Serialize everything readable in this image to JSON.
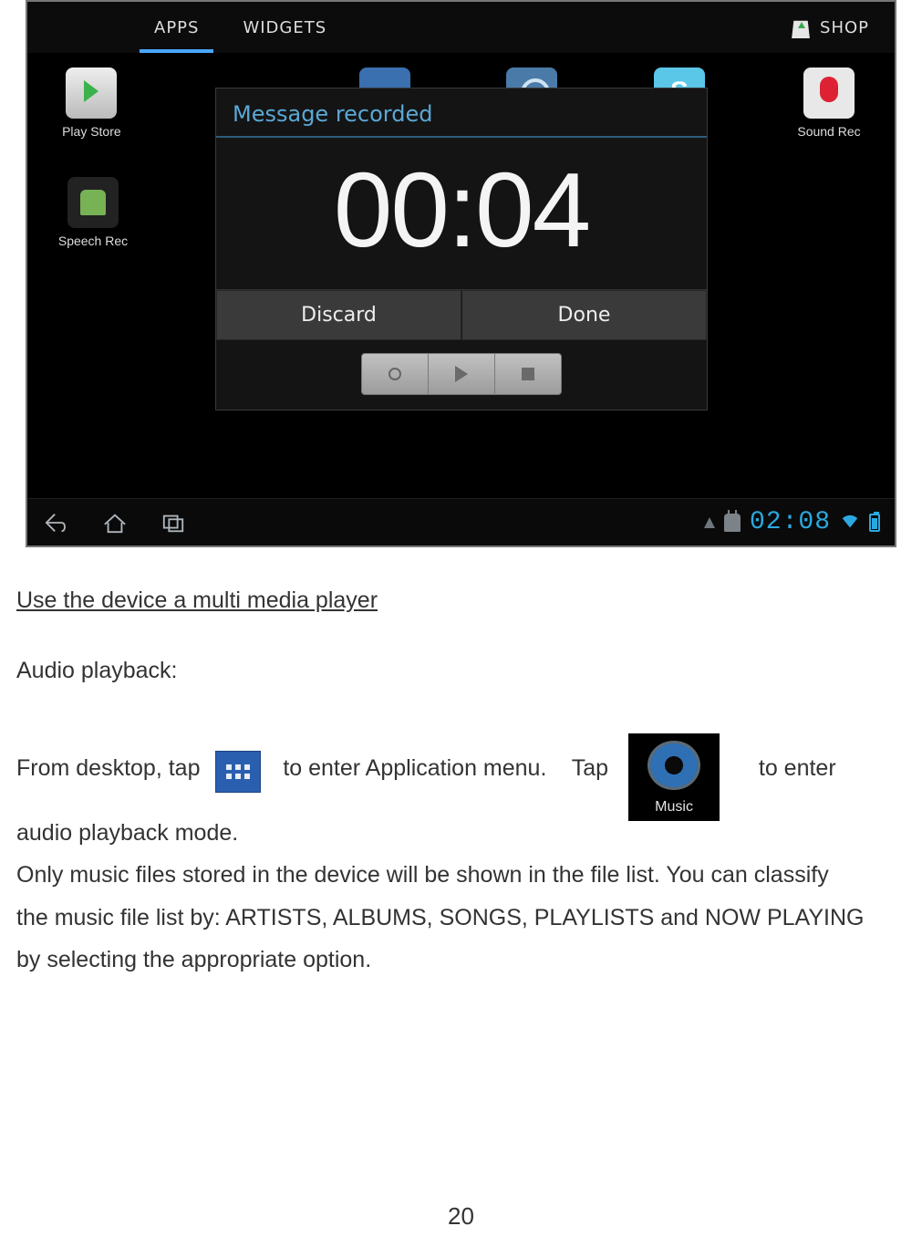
{
  "screenshot": {
    "tabs": {
      "apps": "APPS",
      "widgets": "WIDGETS",
      "shop": "SHOP"
    },
    "apps_row": {
      "play_store": "Play Store",
      "speech_rec": "Speech Rec",
      "sound_rec": "Sound Rec"
    },
    "dialog": {
      "title": "Message recorded",
      "timer": "00:04",
      "discard": "Discard",
      "done": "Done"
    },
    "clock": "02:08"
  },
  "doc": {
    "section_title": "Use the device a multi media player",
    "audio_heading": "Audio playback:",
    "line1_a": "From desktop, tap ",
    "line1_b": "  to enter Application menu.    Tap",
    "line1_c": "   to enter",
    "line2": "audio playback mode.",
    "para2_l1": "Only music files stored in the device will be shown in the file list.    You can classify",
    "para2_l2": "the music file list by: ARTISTS, ALBUMS, SONGS, PLAYLISTS and NOW PLAYING",
    "para2_l3": "by selecting the appropriate option.",
    "music_label": "Music",
    "page_number": "20"
  }
}
